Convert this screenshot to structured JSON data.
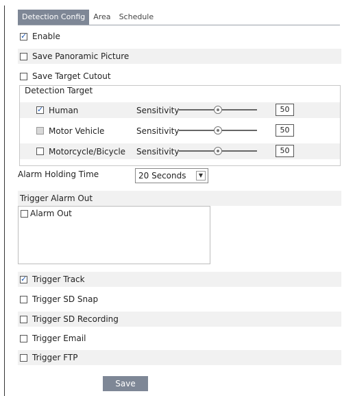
{
  "tabs": [
    {
      "label": "Detection Config",
      "active": true
    },
    {
      "label": "Area",
      "active": false
    },
    {
      "label": "Schedule",
      "active": false
    }
  ],
  "options": {
    "enable": {
      "label": "Enable",
      "checked": true
    },
    "save_panoramic": {
      "label": "Save Panoramic Picture",
      "checked": false
    },
    "save_target_cutout": {
      "label": "Save Target Cutout",
      "checked": false
    }
  },
  "detection_target": {
    "legend": "Detection Target",
    "sensitivity_label": "Sensitivity",
    "targets": [
      {
        "label": "Human",
        "checked": true,
        "sensitivity": "50"
      },
      {
        "label": "Motor Vehicle",
        "checked": false,
        "sensitivity": "50"
      },
      {
        "label": "Motorcycle/Bicycle",
        "checked": false,
        "sensitivity": "50"
      }
    ]
  },
  "alarm_holding_time": {
    "label": "Alarm Holding Time",
    "value": "20 Seconds"
  },
  "trigger_alarm_out": {
    "label": "Trigger Alarm Out",
    "items": [
      {
        "label": "Alarm Out",
        "checked": false
      }
    ]
  },
  "triggers": [
    {
      "label": "Trigger Track",
      "checked": true
    },
    {
      "label": "Trigger SD Snap",
      "checked": false
    },
    {
      "label": "Trigger SD Recording",
      "checked": false
    },
    {
      "label": "Trigger Email",
      "checked": false
    },
    {
      "label": "Trigger FTP",
      "checked": false
    }
  ],
  "save_label": "Save",
  "colors": {
    "tab_active": "#7e8796",
    "row_shade": "#f1f1f1",
    "check": "#1a56b0"
  }
}
